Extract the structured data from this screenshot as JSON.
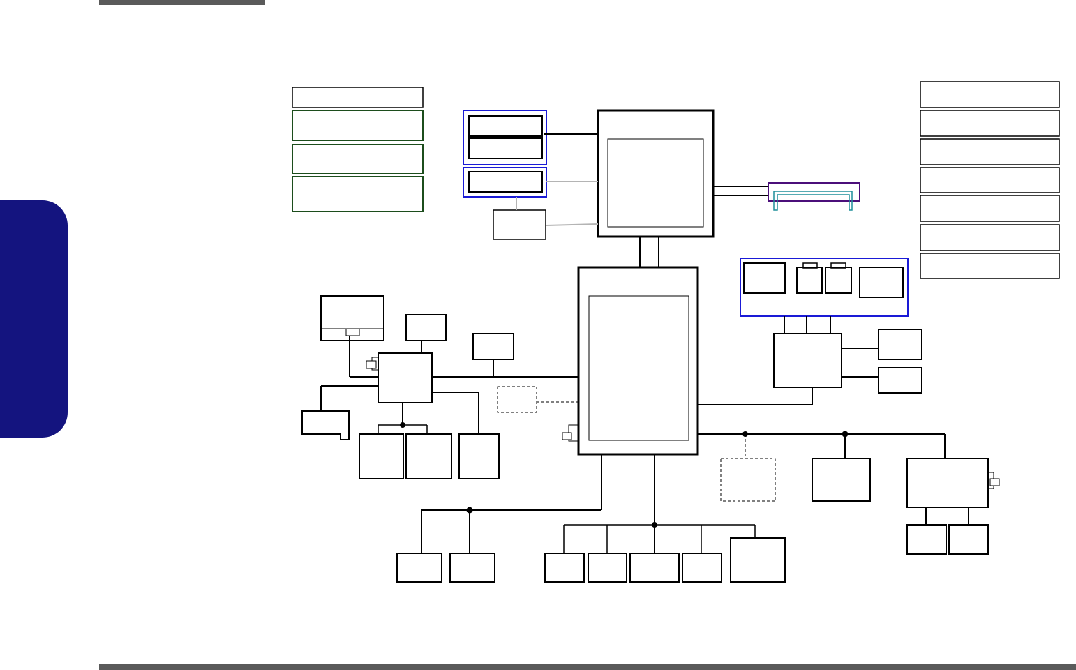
{
  "colors": {
    "header_bar": "#5a5a5a",
    "side_tab": "#14147f",
    "memory_group_outline": "#1a1ad6",
    "legend_box_outline": "#1c4d1c",
    "display_connector_outer": "#4b0f7a",
    "display_connector_inner": "#1e8f9a",
    "component_outline": "#000000",
    "optional_outline": "#000000",
    "gray_link": "#b4b4b4"
  },
  "icons": {
    "crystal": "crystal-oscillator-icon",
    "junction": "junction-dot-icon"
  },
  "labels": {
    "legend_boxes": [
      "",
      "",
      "",
      ""
    ],
    "spec_boxes": [
      "",
      "",
      "",
      "",
      "",
      "",
      ""
    ],
    "cpu": "",
    "pch": "",
    "component": ""
  }
}
